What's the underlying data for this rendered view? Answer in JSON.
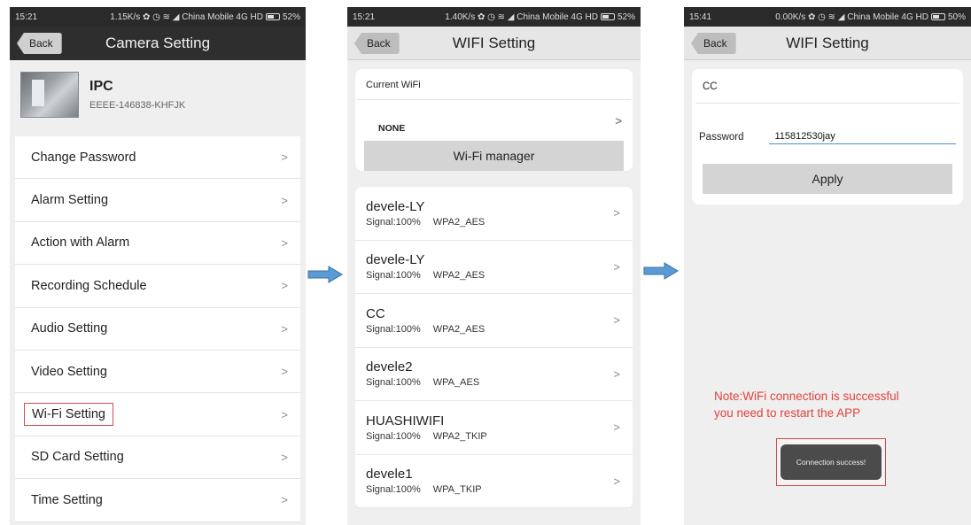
{
  "colors": {
    "arrow": "#5b9bd5",
    "arrow_border": "#3a6fa8",
    "highlight": "#d84a4a",
    "note": "#e0433a",
    "input_underline": "#4a90d9"
  },
  "panel1": {
    "status": {
      "time": "15:21",
      "info": "1.15K/s ✿ ◷ ≋ ◢ China Mobile 4G HD",
      "battery": "52%"
    },
    "back": "Back",
    "title": "Camera Setting",
    "device": {
      "name": "IPC",
      "id": "EEEE-146838-KHFJK"
    },
    "menu": [
      {
        "label": "Change Password"
      },
      {
        "label": "Alarm Setting"
      },
      {
        "label": "Action with Alarm"
      },
      {
        "label": "Recording Schedule"
      },
      {
        "label": "Audio Setting"
      },
      {
        "label": "Video Setting"
      },
      {
        "label": "Wi-Fi Setting"
      },
      {
        "label": "SD Card Setting"
      },
      {
        "label": "Time Setting"
      }
    ],
    "chevron": ">"
  },
  "panel2": {
    "status": {
      "time": "15:21",
      "info": "1.40K/s ✿ ◷ ≋ ◢ China Mobile 4G HD",
      "battery": "52%"
    },
    "back": "Back",
    "title": "WIFI Setting",
    "current_label": "Current WiFi",
    "current_value": "NONE",
    "manager_label": "Wi-Fi manager",
    "chevron": ">",
    "networks": [
      {
        "ssid": "devele-LY",
        "signal": "Signal:100%",
        "security": "WPA2_AES"
      },
      {
        "ssid": "devele-LY",
        "signal": "Signal:100%",
        "security": "WPA2_AES"
      },
      {
        "ssid": "CC",
        "signal": "Signal:100%",
        "security": "WPA2_AES"
      },
      {
        "ssid": "devele2",
        "signal": "Signal:100%",
        "security": "WPA_AES"
      },
      {
        "ssid": "HUASHIWIFI",
        "signal": "Signal:100%",
        "security": "WPA2_TKIP"
      },
      {
        "ssid": "devele1",
        "signal": "Signal:100%",
        "security": "WPA_TKIP"
      }
    ]
  },
  "panel3": {
    "status": {
      "time": "15:41",
      "info": "0.00K/s ✿ ◷ ≋ ◢ China Mobile 4G HD",
      "battery": "50%"
    },
    "back": "Back",
    "title": "WIFI Setting",
    "ssid": "CC",
    "password_label": "Password",
    "password_value": "115812530jay",
    "apply_label": "Apply",
    "note_line1": "Note:WiFi connection is successful",
    "note_line2": "you need to restart the APP",
    "toast": "Connection success!"
  }
}
